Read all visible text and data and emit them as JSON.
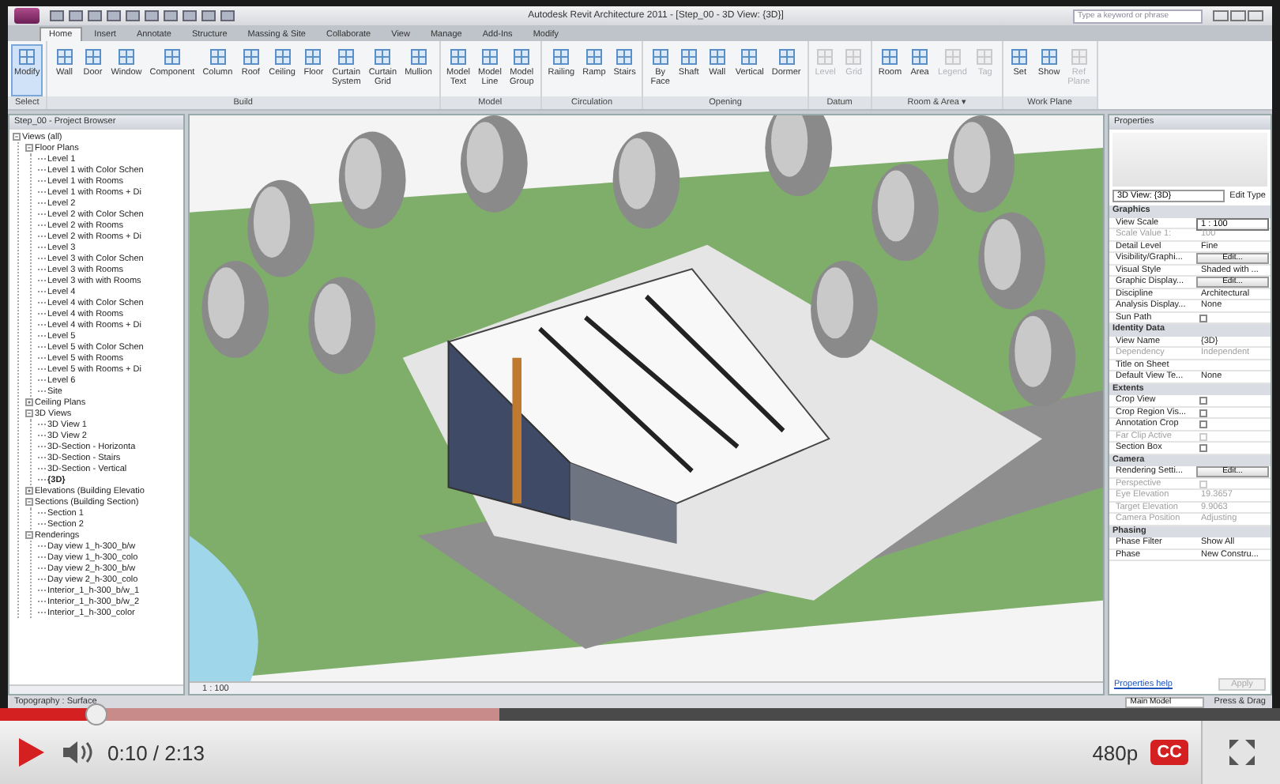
{
  "app": {
    "title": "Autodesk Revit Architecture 2011 - [Step_00 - 3D View: {3D}]",
    "search": {
      "placeholder": "Type a keyword or phrase"
    }
  },
  "ribbon": {
    "tabs": [
      {
        "label": "Home",
        "selected": true
      },
      {
        "label": "Insert",
        "selected": false
      },
      {
        "label": "Annotate",
        "selected": false
      },
      {
        "label": "Structure",
        "selected": false
      },
      {
        "label": "Massing & Site",
        "selected": false
      },
      {
        "label": "Collaborate",
        "selected": false
      },
      {
        "label": "View",
        "selected": false
      },
      {
        "label": "Manage",
        "selected": false
      },
      {
        "label": "Add-Ins",
        "selected": false
      },
      {
        "label": "Modify",
        "selected": false
      }
    ],
    "groups": [
      {
        "label": "Select",
        "tools": [
          {
            "label": "Modify",
            "selected": true,
            "disabled": false
          }
        ]
      },
      {
        "label": "Build",
        "tools": [
          {
            "label": "Wall",
            "selected": false,
            "disabled": false
          },
          {
            "label": "Door",
            "selected": false,
            "disabled": false
          },
          {
            "label": "Window",
            "selected": false,
            "disabled": false
          },
          {
            "label": "Component",
            "selected": false,
            "disabled": false
          },
          {
            "label": "Column",
            "selected": false,
            "disabled": false
          },
          {
            "label": "Roof",
            "selected": false,
            "disabled": false
          },
          {
            "label": "Ceiling",
            "selected": false,
            "disabled": false
          },
          {
            "label": "Floor",
            "selected": false,
            "disabled": false
          },
          {
            "label": "Curtain System",
            "selected": false,
            "disabled": false
          },
          {
            "label": "Curtain Grid",
            "selected": false,
            "disabled": false
          },
          {
            "label": "Mullion",
            "selected": false,
            "disabled": false
          }
        ]
      },
      {
        "label": "Model",
        "tools": [
          {
            "label": "Model Text",
            "selected": false,
            "disabled": false
          },
          {
            "label": "Model Line",
            "selected": false,
            "disabled": false
          },
          {
            "label": "Model Group",
            "selected": false,
            "disabled": false
          }
        ]
      },
      {
        "label": "Circulation",
        "tools": [
          {
            "label": "Railing",
            "selected": false,
            "disabled": false
          },
          {
            "label": "Ramp",
            "selected": false,
            "disabled": false
          },
          {
            "label": "Stairs",
            "selected": false,
            "disabled": false
          }
        ]
      },
      {
        "label": "Opening",
        "tools": [
          {
            "label": "By Face",
            "selected": false,
            "disabled": false
          },
          {
            "label": "Shaft",
            "selected": false,
            "disabled": false
          },
          {
            "label": "Wall",
            "selected": false,
            "disabled": false
          },
          {
            "label": "Vertical",
            "selected": false,
            "disabled": false
          },
          {
            "label": "Dormer",
            "selected": false,
            "disabled": false
          }
        ]
      },
      {
        "label": "Datum",
        "tools": [
          {
            "label": "Level",
            "selected": false,
            "disabled": true
          },
          {
            "label": "Grid",
            "selected": false,
            "disabled": true
          }
        ]
      },
      {
        "label": "Room & Area ▾",
        "tools": [
          {
            "label": "Room",
            "selected": false,
            "disabled": false
          },
          {
            "label": "Area",
            "selected": false,
            "disabled": false
          },
          {
            "label": "Legend",
            "selected": false,
            "disabled": true
          },
          {
            "label": "Tag",
            "selected": false,
            "disabled": true
          }
        ]
      },
      {
        "label": "Work Plane",
        "tools": [
          {
            "label": "Set",
            "selected": false,
            "disabled": false
          },
          {
            "label": "Show",
            "selected": false,
            "disabled": false
          },
          {
            "label": "Ref Plane",
            "selected": false,
            "disabled": true
          }
        ]
      }
    ]
  },
  "project_browser": {
    "title": "Step_00 - Project Browser",
    "tree": [
      {
        "label": "Views (all)",
        "expanded": true,
        "selected": false,
        "children": [
          {
            "label": "Floor Plans",
            "expanded": true,
            "selected": false,
            "children": [
              {
                "label": "Level 1",
                "selected": false
              },
              {
                "label": "Level 1 with Color Schen",
                "selected": false
              },
              {
                "label": "Level 1 with Rooms",
                "selected": false
              },
              {
                "label": "Level 1 with Rooms + Di",
                "selected": false
              },
              {
                "label": "Level 2",
                "selected": false
              },
              {
                "label": "Level 2 with Color Schen",
                "selected": false
              },
              {
                "label": "Level 2 with Rooms",
                "selected": false
              },
              {
                "label": "Level 2 with Rooms + Di",
                "selected": false
              },
              {
                "label": "Level 3",
                "selected": false
              },
              {
                "label": "Level 3 with Color Schen",
                "selected": false
              },
              {
                "label": "Level 3 with Rooms",
                "selected": false
              },
              {
                "label": "Level 3 with with Rooms",
                "selected": false
              },
              {
                "label": "Level 4",
                "selected": false
              },
              {
                "label": "Level 4 with Color Schen",
                "selected": false
              },
              {
                "label": "Level 4 with Rooms",
                "selected": false
              },
              {
                "label": "Level 4 with Rooms + Di",
                "selected": false
              },
              {
                "label": "Level 5",
                "selected": false
              },
              {
                "label": "Level 5 with Color Schen",
                "selected": false
              },
              {
                "label": "Level 5 with Rooms",
                "selected": false
              },
              {
                "label": "Level 5 with Rooms + Di",
                "selected": false
              },
              {
                "label": "Level 6",
                "selected": false
              },
              {
                "label": "Site",
                "selected": false
              }
            ]
          },
          {
            "label": "Ceiling Plans",
            "expanded": false,
            "selected": false
          },
          {
            "label": "3D Views",
            "expanded": true,
            "selected": false,
            "children": [
              {
                "label": "3D View 1",
                "selected": false
              },
              {
                "label": "3D View 2",
                "selected": false
              },
              {
                "label": "3D-Section - Horizonta",
                "selected": false
              },
              {
                "label": "3D-Section - Stairs",
                "selected": false
              },
              {
                "label": "3D-Section - Vertical",
                "selected": false
              },
              {
                "label": "{3D}",
                "selected": true
              }
            ]
          },
          {
            "label": "Elevations (Building Elevatio",
            "expanded": false,
            "selected": false
          },
          {
            "label": "Sections (Building Section)",
            "expanded": true,
            "selected": false,
            "children": [
              {
                "label": "Section 1",
                "selected": false
              },
              {
                "label": "Section 2",
                "selected": false
              }
            ]
          },
          {
            "label": "Renderings",
            "expanded": true,
            "selected": false,
            "children": [
              {
                "label": "Day view 1_h-300_b/w",
                "selected": false
              },
              {
                "label": "Day view 1_h-300_colo",
                "selected": false
              },
              {
                "label": "Day view 2_h-300_b/w",
                "selected": false
              },
              {
                "label": "Day view 2_h-300_colo",
                "selected": false
              },
              {
                "label": "Interior_1_h-300_b/w_1",
                "selected": false
              },
              {
                "label": "Interior_1_h-300_b/w_2",
                "selected": false
              },
              {
                "label": "Interior_1_h-300_color",
                "selected": false
              }
            ]
          }
        ]
      }
    ]
  },
  "viewport": {
    "scale": "1 : 100"
  },
  "properties": {
    "title": "Properties",
    "type_selector": "3D View: {3D}",
    "edit_type": "Edit Type",
    "sections": [
      {
        "title": "Graphics",
        "rows": [
          {
            "kind": "input",
            "label": "View Scale",
            "value": "1 : 100",
            "disabled": false
          },
          {
            "kind": "text",
            "label": "Scale Value    1:",
            "value": "100",
            "disabled": true
          },
          {
            "kind": "text",
            "label": "Detail Level",
            "value": "Fine",
            "disabled": false
          },
          {
            "kind": "button",
            "label": "Visibility/Graphi...",
            "value": "Edit...",
            "disabled": false
          },
          {
            "kind": "text",
            "label": "Visual Style",
            "value": "Shaded with ...",
            "disabled": false
          },
          {
            "kind": "button",
            "label": "Graphic Display...",
            "value": "Edit...",
            "disabled": false
          },
          {
            "kind": "text",
            "label": "Discipline",
            "value": "Architectural",
            "disabled": false
          },
          {
            "kind": "text",
            "label": "Analysis Display...",
            "value": "None",
            "disabled": false
          },
          {
            "kind": "checkbox",
            "label": "Sun Path",
            "checked": false,
            "disabled": false
          }
        ]
      },
      {
        "title": "Identity Data",
        "rows": [
          {
            "kind": "text",
            "label": "View Name",
            "value": "{3D}",
            "disabled": false
          },
          {
            "kind": "text",
            "label": "Dependency",
            "value": "Independent",
            "disabled": true
          },
          {
            "kind": "text",
            "label": "Title on Sheet",
            "disabled": false
          },
          {
            "kind": "text",
            "label": "Default View Te...",
            "value": "None",
            "disabled": false
          }
        ]
      },
      {
        "title": "Extents",
        "rows": [
          {
            "kind": "checkbox",
            "label": "Crop View",
            "checked": false,
            "disabled": false
          },
          {
            "kind": "checkbox",
            "label": "Crop Region Vis...",
            "checked": false,
            "disabled": false
          },
          {
            "kind": "checkbox",
            "label": "Annotation Crop",
            "checked": false,
            "disabled": false
          },
          {
            "kind": "checkbox",
            "label": "Far Clip Active",
            "checked": false,
            "disabled": true
          },
          {
            "kind": "checkbox",
            "label": "Section Box",
            "checked": false,
            "disabled": false
          }
        ]
      },
      {
        "title": "Camera",
        "rows": [
          {
            "kind": "button",
            "label": "Rendering Setti...",
            "value": "Edit...",
            "disabled": false
          },
          {
            "kind": "checkbox",
            "label": "Perspective",
            "checked": false,
            "disabled": true
          },
          {
            "kind": "text",
            "label": "Eye Elevation",
            "value": "19.3657",
            "disabled": true
          },
          {
            "kind": "text",
            "label": "Target Elevation",
            "value": "9.9063",
            "disabled": true
          },
          {
            "kind": "text",
            "label": "Camera Position",
            "value": "Adjusting",
            "disabled": true
          }
        ]
      },
      {
        "title": "Phasing",
        "rows": [
          {
            "kind": "text",
            "label": "Phase Filter",
            "value": "Show All",
            "disabled": false
          },
          {
            "kind": "text",
            "label": "Phase",
            "value": "New Constru...",
            "disabled": false
          }
        ]
      }
    ],
    "help_link": "Properties help",
    "apply": {
      "label": "Apply",
      "disabled": true
    }
  },
  "status_bar": {
    "text": "Topography : Surface",
    "model": "Main Model",
    "press_drag": "Press & Drag"
  },
  "player": {
    "progress": {
      "level": 0.075
    },
    "buffered": {
      "level": 0.39
    },
    "time": "0:10 / 2:13",
    "quality": "480p",
    "captions": "CC"
  }
}
